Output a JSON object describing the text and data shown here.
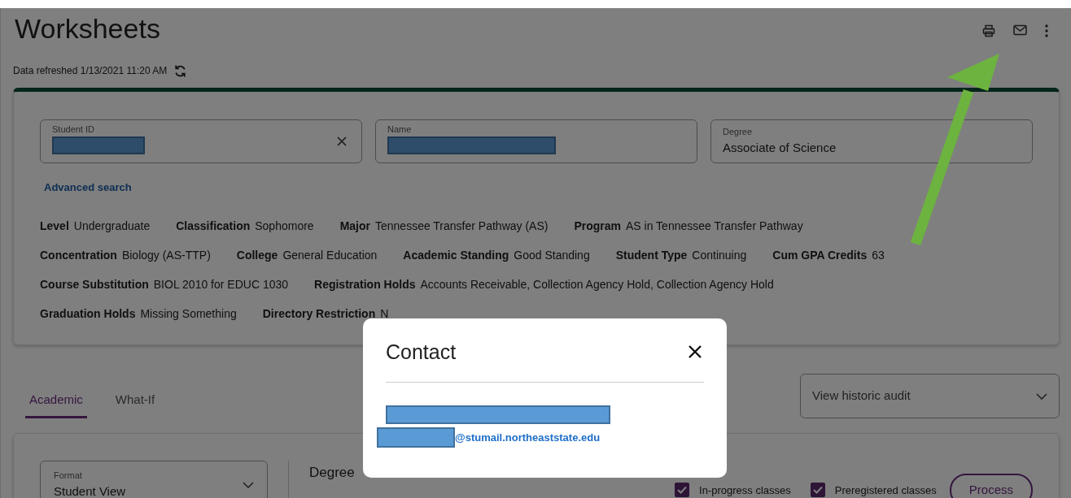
{
  "page": {
    "title": "Worksheets",
    "refreshed": "Data refreshed 1/13/2021 11:20 AM"
  },
  "search_fields": [
    {
      "label": "Student ID",
      "redacted": true,
      "clearable": true
    },
    {
      "label": "Name",
      "redacted": true,
      "clearable": false
    },
    {
      "label": "Degree",
      "value": "Associate of Science",
      "redacted": false,
      "clearable": false
    }
  ],
  "advanced_search": "Advanced search",
  "attribute_rows": [
    [
      {
        "label": "Level",
        "value": "Undergraduate"
      },
      {
        "label": "Classification",
        "value": "Sophomore"
      },
      {
        "label": "Major",
        "value": "Tennessee Transfer Pathway (AS)"
      },
      {
        "label": "Program",
        "value": "AS in Tennessee Transfer Pathway"
      }
    ],
    [
      {
        "label": "Concentration",
        "value": "Biology (AS-TTP)"
      },
      {
        "label": "College",
        "value": "General Education"
      },
      {
        "label": "Academic Standing",
        "value": "Good Standing"
      },
      {
        "label": "Student Type",
        "value": "Continuing"
      },
      {
        "label": "Cum GPA Credits",
        "value": "63"
      }
    ],
    [
      {
        "label": "Course Substitution",
        "value": "BIOL 2010 for EDUC 1030"
      },
      {
        "label": "Registration Holds",
        "value": "Accounts Receivable, Collection Agency Hold, Collection Agency Hold"
      }
    ],
    [
      {
        "label": "Graduation Holds",
        "value": "Missing Something"
      },
      {
        "label": "Directory Restriction",
        "value": "N"
      }
    ]
  ],
  "tabs": [
    {
      "label": "Academic",
      "selected": true
    },
    {
      "label": "What-If",
      "selected": false
    }
  ],
  "historic_audit": {
    "value": "View historic audit"
  },
  "format": {
    "label": "Format",
    "value": "Student View"
  },
  "degree_progress_heading": "Degree",
  "options": [
    {
      "label": "In-progress classes",
      "checked": true
    },
    {
      "label": "Preregistered classes",
      "checked": true
    }
  ],
  "process_button": "Process",
  "modal": {
    "title": "Contact",
    "name_redacted": true,
    "email_prefix_redacted": true,
    "email_suffix": "@stumail.northeaststate.edu"
  }
}
